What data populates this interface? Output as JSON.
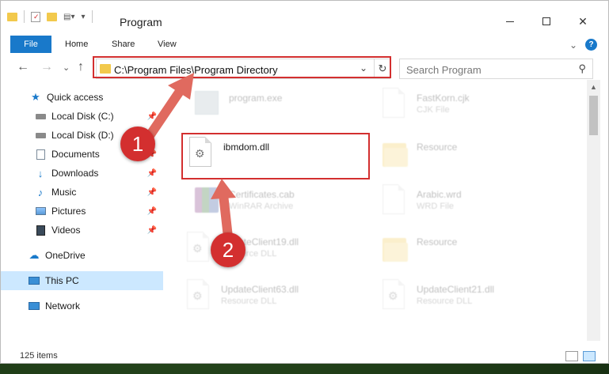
{
  "window": {
    "title": "Program"
  },
  "ribbon": {
    "file": "File",
    "home": "Home",
    "share": "Share",
    "view": "View",
    "help": "?"
  },
  "nav": {
    "back": "←",
    "forward": "→",
    "recent": "⌄",
    "up": "↑"
  },
  "address": {
    "path": "C:\\Program Files\\Program Directory"
  },
  "search": {
    "placeholder": "Search Program"
  },
  "sidebar": {
    "items": [
      {
        "label": "Quick access",
        "icon": "star-icon"
      },
      {
        "label": "Local Disk (C:)",
        "icon": "drive-icon"
      },
      {
        "label": "Local Disk (D:)",
        "icon": "drive-icon"
      },
      {
        "label": "Documents",
        "icon": "documents-icon"
      },
      {
        "label": "Downloads",
        "icon": "downloads-icon"
      },
      {
        "label": "Music",
        "icon": "music-icon"
      },
      {
        "label": "Pictures",
        "icon": "pictures-icon"
      },
      {
        "label": "Videos",
        "icon": "videos-icon"
      },
      {
        "label": "OneDrive",
        "icon": "cloud-icon"
      },
      {
        "label": "This PC",
        "icon": "computer-icon"
      },
      {
        "label": "Network",
        "icon": "network-icon"
      }
    ]
  },
  "files": [
    {
      "name": "program.exe",
      "type": ""
    },
    {
      "name": "FastKorn.cjk",
      "type": "CJK File"
    },
    {
      "name": "ibmdom.dll",
      "type": ""
    },
    {
      "name": "Resource",
      "type": ""
    },
    {
      "name": "Certificates.cab",
      "type": "WinRAR Archive"
    },
    {
      "name": "Arabic.wrd",
      "type": "WRD File"
    },
    {
      "name": "UpdateClient19.dll",
      "type": "Resource DLL"
    },
    {
      "name": "Resource",
      "type": ""
    },
    {
      "name": "UpdateClient63.dll",
      "type": "Resource DLL"
    },
    {
      "name": "UpdateClient21.dll",
      "type": "Resource DLL"
    }
  ],
  "status": {
    "count": "125 items"
  },
  "annotations": {
    "step1": "1",
    "step2": "2"
  },
  "colors": {
    "accent": "#1979ca",
    "highlight": "#d32f2f",
    "selected": "#cce8ff",
    "folder": "#f2c94c"
  }
}
